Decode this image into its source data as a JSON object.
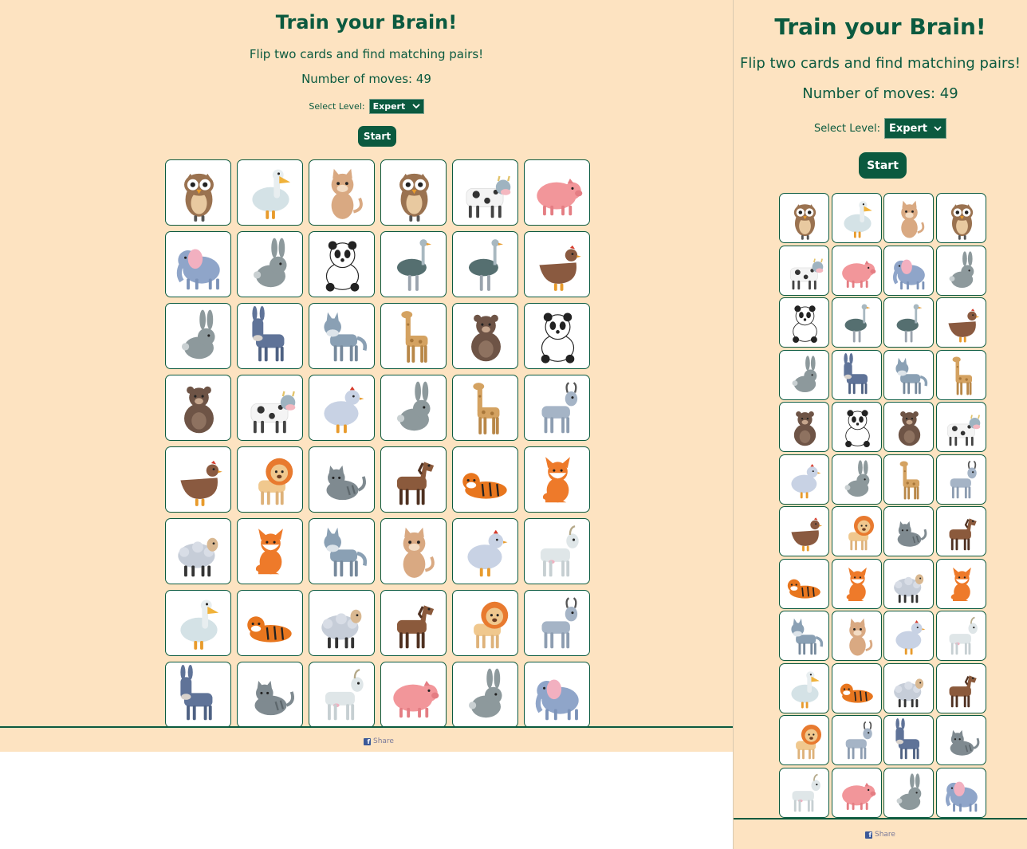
{
  "header": {
    "title": "Train your Brain!",
    "subtitle": "Flip two cards and find matching pairs!",
    "moves_label": "Number of moves: 49",
    "level_label": "Select Level:",
    "level_value": "Expert",
    "start_label": "Start"
  },
  "footer": {
    "share_label": "Share"
  },
  "colors": {
    "background": "#fde3c1",
    "accent": "#0b5a3f",
    "card": "#ffffff",
    "facebook": "#3b5998"
  },
  "icons": {
    "dropdown": "chevron-down-icon",
    "share": "facebook-icon"
  },
  "desktop": {
    "columns": 6,
    "cards": [
      "owl",
      "pelican",
      "cat",
      "owl",
      "cow",
      "pig",
      "elephant",
      "rabbit",
      "panda",
      "ostrich",
      "ostrich",
      "hen",
      "rabbit",
      "donkey",
      "wolf",
      "giraffe",
      "bear",
      "panda",
      "bear",
      "cow",
      "chicken",
      "rabbit",
      "giraffe",
      "goat",
      "hen",
      "lion",
      "gray-cat",
      "horse",
      "tiger",
      "fox",
      "sheep",
      "fox",
      "wolf",
      "cat",
      "chicken",
      "white-goat",
      "pelican",
      "tiger",
      "sheep",
      "horse",
      "lion",
      "goat",
      "donkey",
      "gray-cat",
      "white-goat",
      "pig",
      "rabbit",
      "elephant"
    ]
  },
  "mobile": {
    "columns": 4,
    "cards": [
      "owl",
      "pelican",
      "cat",
      "owl",
      "cow",
      "pig",
      "elephant",
      "rabbit",
      "panda",
      "ostrich",
      "ostrich",
      "hen",
      "rabbit",
      "donkey",
      "wolf",
      "giraffe",
      "bear",
      "panda",
      "bear",
      "cow",
      "chicken",
      "rabbit",
      "giraffe",
      "goat",
      "hen",
      "lion",
      "gray-cat",
      "horse",
      "tiger",
      "fox",
      "sheep",
      "fox",
      "wolf",
      "cat",
      "chicken",
      "white-goat",
      "pelican",
      "tiger",
      "sheep",
      "horse",
      "lion",
      "goat",
      "donkey",
      "gray-cat",
      "white-goat",
      "pig",
      "rabbit",
      "elephant"
    ]
  }
}
